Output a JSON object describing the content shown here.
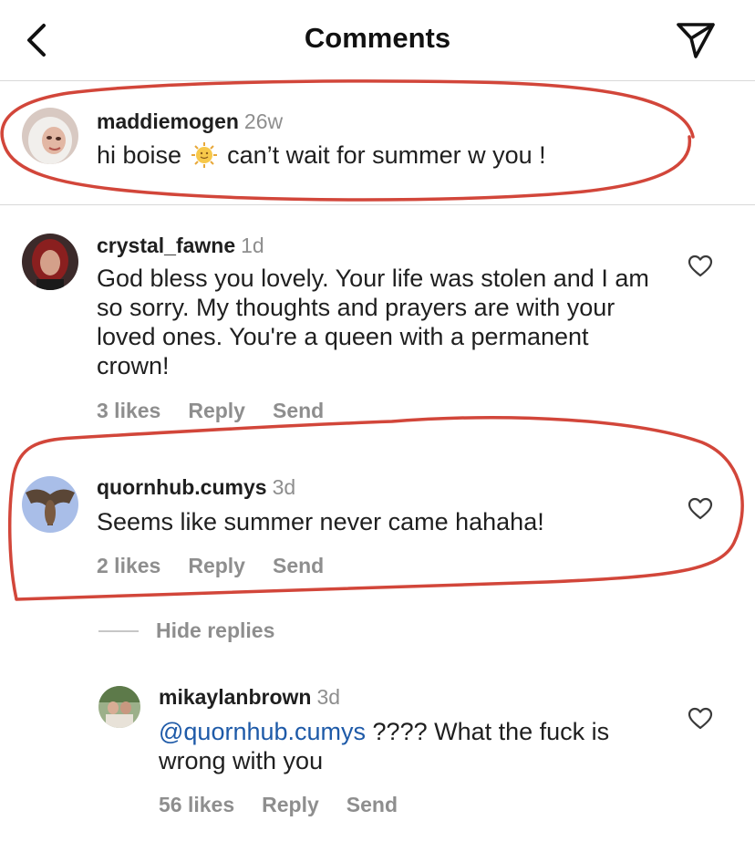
{
  "header": {
    "title": "Comments",
    "back_icon": "chevron-left-icon",
    "send_icon": "paper-plane-icon"
  },
  "comments": [
    {
      "username": "maddiemogen",
      "time": "26w",
      "text_before": "hi boise",
      "emoji": "sun-with-face-emoji",
      "text_after": "can’t wait for summer w you !"
    },
    {
      "username": "crystal_fawne",
      "time": "1d",
      "text": "God bless you lovely.  Your life was stolen and I am so sorry. My thoughts and prayers are with your loved ones. You're a queen with a permanent crown!",
      "likes": "3 likes",
      "reply": "Reply",
      "send": "Send"
    },
    {
      "username": "quornhub.cumys",
      "time": "3d",
      "text": "Seems like summer never came hahaha!",
      "likes": "2 likes",
      "reply": "Reply",
      "send": "Send"
    }
  ],
  "hide_replies": "Hide replies",
  "replies": [
    {
      "username": "mikaylanbrown",
      "time": "3d",
      "mention": "@quornhub.cumys",
      "text": " ???? What the fuck is wrong with you",
      "likes": "56 likes",
      "reply": "Reply",
      "send": "Send"
    }
  ],
  "colors": {
    "annotation": "#d2463a",
    "mention": "#1e5aa8",
    "secondary_text": "#8e8e8e"
  }
}
